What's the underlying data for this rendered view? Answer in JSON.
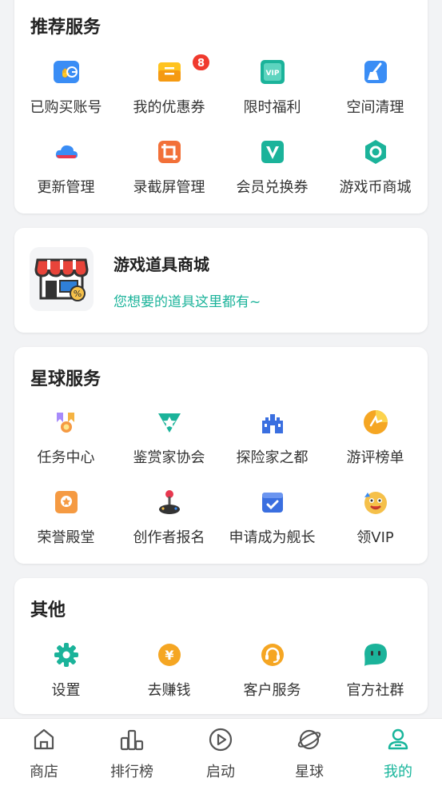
{
  "recommended": {
    "title": "推荐服务",
    "items": [
      {
        "label": "已购买账号",
        "icon": "account-icon"
      },
      {
        "label": "我的优惠券",
        "icon": "coupon-icon",
        "badge": "8"
      },
      {
        "label": "限时福利",
        "icon": "vip-welfare-icon"
      },
      {
        "label": "空间清理",
        "icon": "broom-icon"
      },
      {
        "label": "更新管理",
        "icon": "cloud-icon"
      },
      {
        "label": "录截屏管理",
        "icon": "crop-icon"
      },
      {
        "label": "会员兑换券",
        "icon": "v-badge-icon"
      },
      {
        "label": "游戏币商城",
        "icon": "coin-hex-icon"
      }
    ]
  },
  "promo": {
    "title": "游戏道具商城",
    "subtitle": "您想要的道具这里都有~"
  },
  "planet": {
    "title": "星球服务",
    "items": [
      {
        "label": "任务中心",
        "icon": "task-icon"
      },
      {
        "label": "鉴赏家协会",
        "icon": "appreciator-icon"
      },
      {
        "label": "探险家之都",
        "icon": "castle-icon"
      },
      {
        "label": "游评榜单",
        "icon": "ranking-icon"
      },
      {
        "label": "荣誉殿堂",
        "icon": "honor-icon"
      },
      {
        "label": "创作者报名",
        "icon": "joystick-icon"
      },
      {
        "label": "申请成为舰长",
        "icon": "calendar-check-icon"
      },
      {
        "label": "领VIP",
        "icon": "vip-face-icon"
      }
    ]
  },
  "other": {
    "title": "其他",
    "items": [
      {
        "label": "设置",
        "icon": "gear-icon"
      },
      {
        "label": "去赚钱",
        "icon": "yuan-coin-icon"
      },
      {
        "label": "客户服务",
        "icon": "headset-icon"
      },
      {
        "label": "官方社群",
        "icon": "chat-bubble-icon"
      }
    ]
  },
  "nav": [
    {
      "label": "商店",
      "icon": "shop-icon"
    },
    {
      "label": "排行榜",
      "icon": "chart-icon"
    },
    {
      "label": "启动",
      "icon": "play-icon"
    },
    {
      "label": "星球",
      "icon": "planet-icon"
    },
    {
      "label": "我的",
      "icon": "user-icon",
      "active": true
    }
  ],
  "colors": {
    "accent": "#17b59b",
    "badge": "#f03a2e"
  },
  "vip_icon_text": "VIP"
}
